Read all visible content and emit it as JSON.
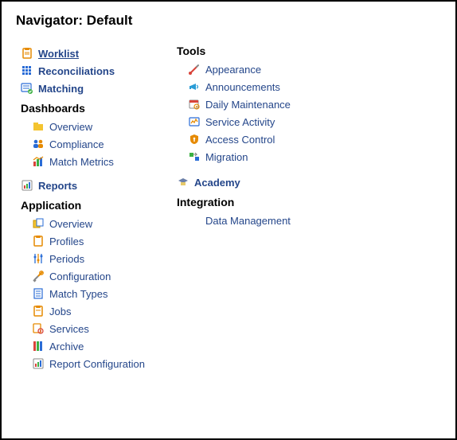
{
  "title": "Navigator: Default",
  "left": {
    "top_items": [
      {
        "id": "worklist",
        "label": "Worklist",
        "bold": true,
        "underline": true
      },
      {
        "id": "reconciliations",
        "label": "Reconciliations",
        "bold": true
      },
      {
        "id": "matching",
        "label": "Matching",
        "bold": true
      }
    ],
    "dashboards_header": "Dashboards",
    "dashboards_items": [
      {
        "id": "dash-overview",
        "label": "Overview"
      },
      {
        "id": "compliance",
        "label": "Compliance"
      },
      {
        "id": "match-metrics",
        "label": "Match Metrics"
      }
    ],
    "reports": {
      "id": "reports",
      "label": "Reports",
      "bold": true
    },
    "application_header": "Application",
    "application_items": [
      {
        "id": "app-overview",
        "label": "Overview"
      },
      {
        "id": "profiles",
        "label": "Profiles"
      },
      {
        "id": "periods",
        "label": "Periods"
      },
      {
        "id": "configuration",
        "label": "Configuration"
      },
      {
        "id": "match-types",
        "label": "Match Types"
      },
      {
        "id": "jobs",
        "label": "Jobs"
      },
      {
        "id": "services",
        "label": "Services"
      },
      {
        "id": "archive",
        "label": "Archive"
      },
      {
        "id": "report-config",
        "label": "Report Configuration"
      }
    ]
  },
  "right": {
    "tools_header": "Tools",
    "tools_items": [
      {
        "id": "appearance",
        "label": "Appearance"
      },
      {
        "id": "announcements",
        "label": "Announcements"
      },
      {
        "id": "daily-maintenance",
        "label": "Daily Maintenance"
      },
      {
        "id": "service-activity",
        "label": "Service Activity"
      },
      {
        "id": "access-control",
        "label": "Access Control"
      },
      {
        "id": "migration",
        "label": "Migration"
      }
    ],
    "academy": {
      "id": "academy",
      "label": "Academy",
      "bold": true
    },
    "integration_header": "Integration",
    "integration_items": [
      {
        "id": "data-management",
        "label": "Data Management"
      }
    ]
  }
}
